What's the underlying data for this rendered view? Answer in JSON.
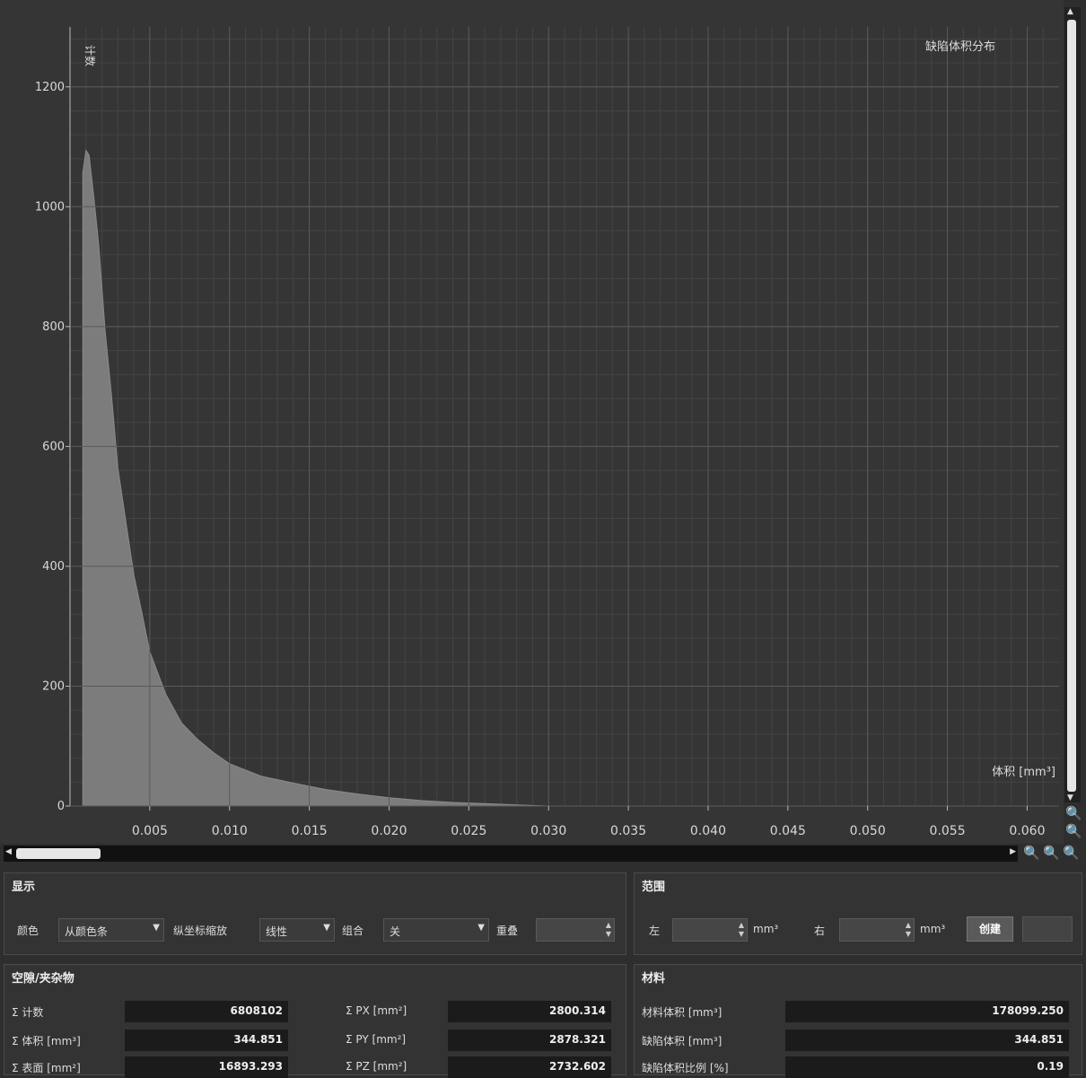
{
  "chart_data": {
    "type": "area",
    "title": "缺陷体积分布",
    "ylabel": "计数",
    "xlabel": "体积 [mm³]",
    "xlim": [
      0,
      0.062
    ],
    "ylim": [
      0,
      1300
    ],
    "x_ticks": [
      "0.005",
      "0.010",
      "0.015",
      "0.020",
      "0.025",
      "0.030",
      "0.035",
      "0.040",
      "0.045",
      "0.050",
      "0.055",
      "0.060"
    ],
    "y_ticks": [
      "0",
      "200",
      "400",
      "600",
      "800",
      "1000",
      "1200"
    ],
    "x": [
      0.0008,
      0.001,
      0.0012,
      0.0015,
      0.0018,
      0.0022,
      0.0026,
      0.003,
      0.0035,
      0.004,
      0.0045,
      0.005,
      0.006,
      0.007,
      0.008,
      0.009,
      0.01,
      0.012,
      0.014,
      0.016,
      0.018,
      0.02,
      0.022,
      0.024,
      0.026,
      0.028,
      0.03
    ],
    "y": [
      1050,
      1100,
      1080,
      1020,
      930,
      800,
      680,
      570,
      470,
      390,
      320,
      260,
      185,
      140,
      110,
      90,
      70,
      50,
      38,
      28,
      20,
      14,
      9,
      6,
      4,
      2,
      0
    ],
    "grid": true,
    "fill_color": "#7c7c7c"
  },
  "panels": {
    "display": {
      "title": "显示",
      "color_label": "颜色",
      "color_value": "从颜色条",
      "yscale_label": "纵坐标缩放",
      "yscale_value": "线性",
      "combine_label": "组合",
      "combine_value": "关",
      "overlap_label": "重叠"
    },
    "range": {
      "title": "范围",
      "left_label": "左",
      "right_label": "右",
      "unit1": "mm³",
      "unit2": "mm³",
      "create_button": "创建",
      "second_button": ""
    },
    "voids": {
      "title": "空隙/夹杂物",
      "rows": [
        {
          "l1": "Σ 计数",
          "v1": "6808102",
          "l2": "Σ PX [mm²]",
          "v2": "2800.314"
        },
        {
          "l1": "Σ 体积 [mm³]",
          "v1": "344.851",
          "l2": "Σ PY [mm²]",
          "v2": "2878.321"
        },
        {
          "l1": "Σ 表面 [mm²]",
          "v1": "16893.293",
          "l2": "Σ PZ [mm²]",
          "v2": "2732.602"
        }
      ]
    },
    "material": {
      "title": "材料",
      "rows": [
        {
          "l": "材料体积 [mm³]",
          "v": "178099.250"
        },
        {
          "l": "缺陷体积 [mm³]",
          "v": "344.851"
        },
        {
          "l": "缺陷体积比例 [%]",
          "v": "0.19"
        }
      ]
    }
  }
}
